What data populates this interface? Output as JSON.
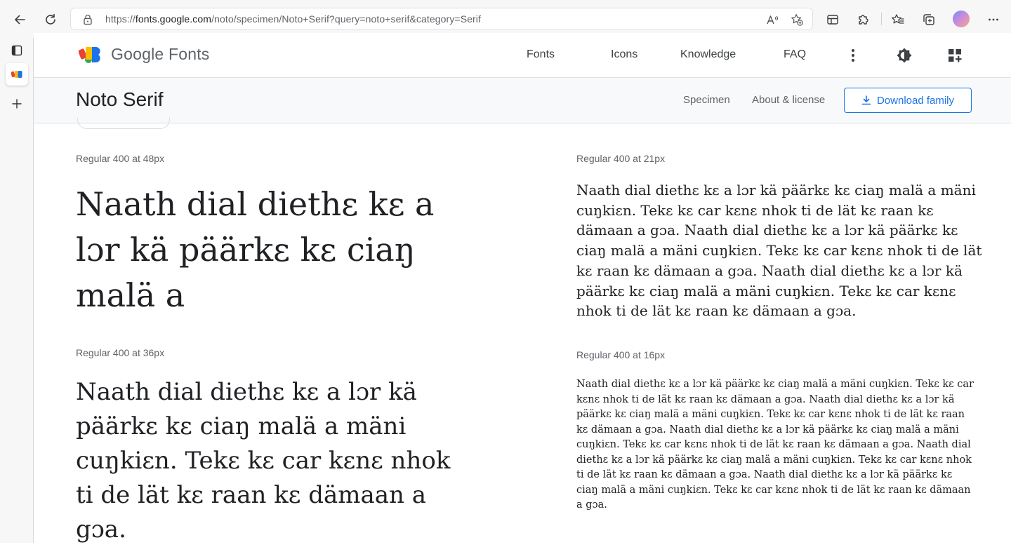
{
  "browser": {
    "url_prefix": "https://",
    "url_domain": "fonts.google.com",
    "url_path": "/noto/specimen/Noto+Serif?query=noto+serif&category=Serif"
  },
  "site": {
    "brand": "Google Fonts",
    "nav": [
      "Fonts",
      "Icons",
      "Knowledge",
      "FAQ"
    ]
  },
  "family": {
    "name": "Noto Serif",
    "tabs": [
      "Specimen",
      "About & license"
    ],
    "download_label": "Download family"
  },
  "specimens": [
    {
      "label": "Regular 400 at 48px",
      "text": "Naath dial diethɛ kɛ a lɔr kä päärkɛ kɛ ciaŋ malä a"
    },
    {
      "label": "Regular 400 at 36px",
      "text": "Naath dial diethɛ kɛ a lɔr kä päärkɛ kɛ ciaŋ malä a mäni cuŋkiɛn. Tekɛ kɛ car kɛnɛ nhok ti de lät kɛ raan kɛ dämaan a gɔa."
    },
    {
      "label": "Regular 400 at 21px",
      "text": "Naath dial diethɛ kɛ a lɔr kä päärkɛ kɛ ciaŋ malä a mäni cuŋkiɛn. Tekɛ kɛ car kɛnɛ nhok ti de lät kɛ raan kɛ dämaan a gɔa. Naath dial diethɛ kɛ a lɔr kä päärkɛ kɛ ciaŋ malä a mäni cuŋkiɛn. Tekɛ kɛ car kɛnɛ nhok ti de lät kɛ raan kɛ dämaan a gɔa. Naath dial diethɛ kɛ a lɔr kä päärkɛ kɛ ciaŋ malä a mäni cuŋkiɛn. Tekɛ kɛ car kɛnɛ nhok ti de lät kɛ raan kɛ dämaan a gɔa."
    },
    {
      "label": "Regular 400 at 16px",
      "text": "Naath dial diethɛ kɛ a lɔr kä päärkɛ kɛ ciaŋ malä a mäni cuŋkiɛn. Tekɛ kɛ car kɛnɛ nhok ti de lät kɛ raan kɛ dämaan a gɔa. Naath dial diethɛ kɛ a lɔr kä päärkɛ kɛ ciaŋ malä a mäni cuŋkiɛn. Tekɛ kɛ car kɛnɛ nhok ti de lät kɛ raan kɛ dämaan a gɔa. Naath dial diethɛ kɛ a lɔr kä päärkɛ kɛ ciaŋ malä a mäni cuŋkiɛn. Tekɛ kɛ car kɛnɛ nhok ti de lät kɛ raan kɛ dämaan a gɔa. Naath dial diethɛ kɛ a lɔr kä päärkɛ kɛ ciaŋ malä a mäni cuŋkiɛn. Tekɛ kɛ car kɛnɛ nhok ti de lät kɛ raan kɛ dämaan a gɔa. Naath dial diethɛ kɛ a lɔr kä päärkɛ kɛ ciaŋ malä a mäni cuŋkiɛn. Tekɛ kɛ car kɛnɛ nhok ti de lät kɛ raan kɛ dämaan a gɔa."
    }
  ],
  "icons": {
    "back": "arrow-left-icon",
    "refresh": "refresh-icon",
    "lock": "lock-icon",
    "read_aloud": "read-aloud-icon",
    "add_favorite": "star-add-icon",
    "app": "app-icon",
    "extensions": "puzzle-icon",
    "favorites": "favorites-icon",
    "collections": "collections-icon",
    "more": "more-horizontal-icon",
    "more_vertical": "more-vertical-icon",
    "theme": "brightness-icon",
    "apps_add": "apps-add-icon",
    "download": "download-icon"
  },
  "colors": {
    "accent": "#1a73e8",
    "text": "#202124",
    "muted": "#5f6368",
    "family_bar_bg": "#f8f9fa"
  }
}
